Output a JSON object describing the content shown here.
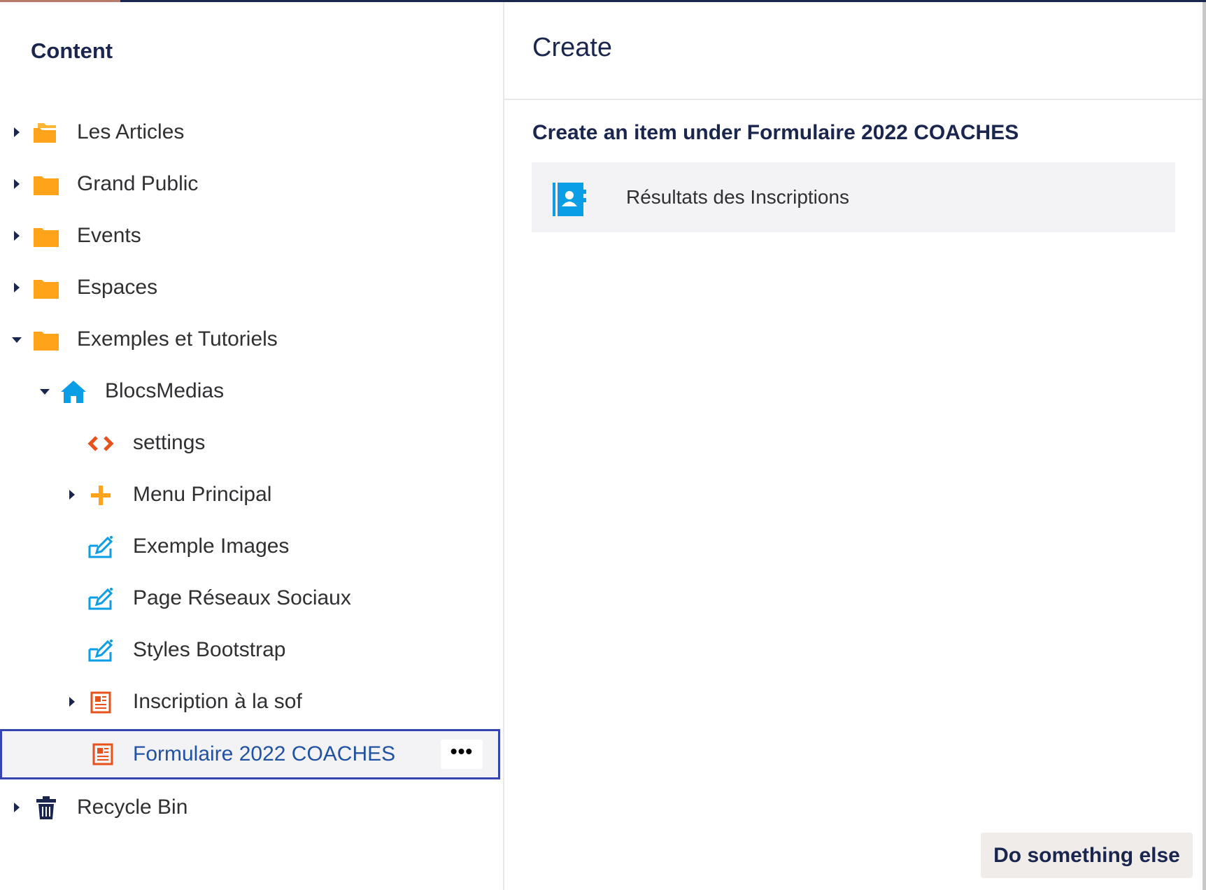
{
  "left_pane": {
    "title": "Content",
    "tree": [
      {
        "label": "Les Articles",
        "icon": "folder-open-icon",
        "caret": "right"
      },
      {
        "label": "Grand Public",
        "icon": "folder-icon",
        "caret": "right"
      },
      {
        "label": "Events",
        "icon": "folder-icon",
        "caret": "right"
      },
      {
        "label": "Espaces",
        "icon": "folder-icon",
        "caret": "right"
      },
      {
        "label": "Exemples et Tutoriels",
        "icon": "folder-icon",
        "caret": "down"
      },
      {
        "label": "BlocsMedias",
        "icon": "home-icon",
        "caret": "down"
      },
      {
        "label": "settings",
        "icon": "code-icon",
        "caret": "none"
      },
      {
        "label": "Menu Principal",
        "icon": "plus-icon",
        "caret": "right"
      },
      {
        "label": "Exemple Images",
        "icon": "edit-icon",
        "caret": "none"
      },
      {
        "label": "Page Réseaux Sociaux",
        "icon": "edit-icon",
        "caret": "none"
      },
      {
        "label": "Styles Bootstrap",
        "icon": "edit-icon",
        "caret": "none"
      },
      {
        "label": "Inscription à la sof",
        "icon": "form-icon",
        "caret": "right"
      },
      {
        "label": "Formulaire 2022 COACHES",
        "icon": "form-icon",
        "caret": "none",
        "selected": true
      },
      {
        "label": "Recycle Bin",
        "icon": "trash-icon",
        "caret": "right"
      }
    ],
    "more_label": "•••"
  },
  "right_pane": {
    "title": "Create",
    "subtitle": "Create an item under Formulaire 2022 COACHES",
    "items": [
      {
        "label": "Résultats des Inscriptions",
        "icon": "contact-book-icon"
      }
    ],
    "do_something_else": "Do something else"
  },
  "colors": {
    "folder": "#ffa31a",
    "accent_blue": "#0a9ee6",
    "code_red": "#e8511c",
    "selection_border": "#3544b1",
    "text_primary": "#1b264f"
  }
}
